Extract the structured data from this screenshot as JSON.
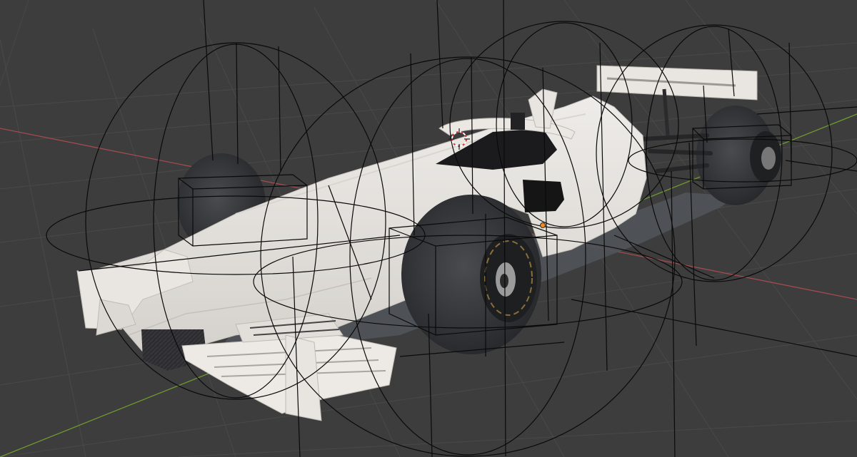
{
  "viewport": {
    "background": "#3d3d3d",
    "grid_color": "#4a4a4a",
    "x_axis_color": "#a44a4f",
    "y_axis_color": "#6f9a2f",
    "wireframe_color": "#0a0a0a",
    "car_body_color": "#e6e3de",
    "tyre_color": "#2e2f31",
    "carbon_color": "#2a2a2c",
    "shadow_color": "#5a5d62",
    "icons": [
      "3d-cursor-icon",
      "object-origin-icon"
    ]
  }
}
